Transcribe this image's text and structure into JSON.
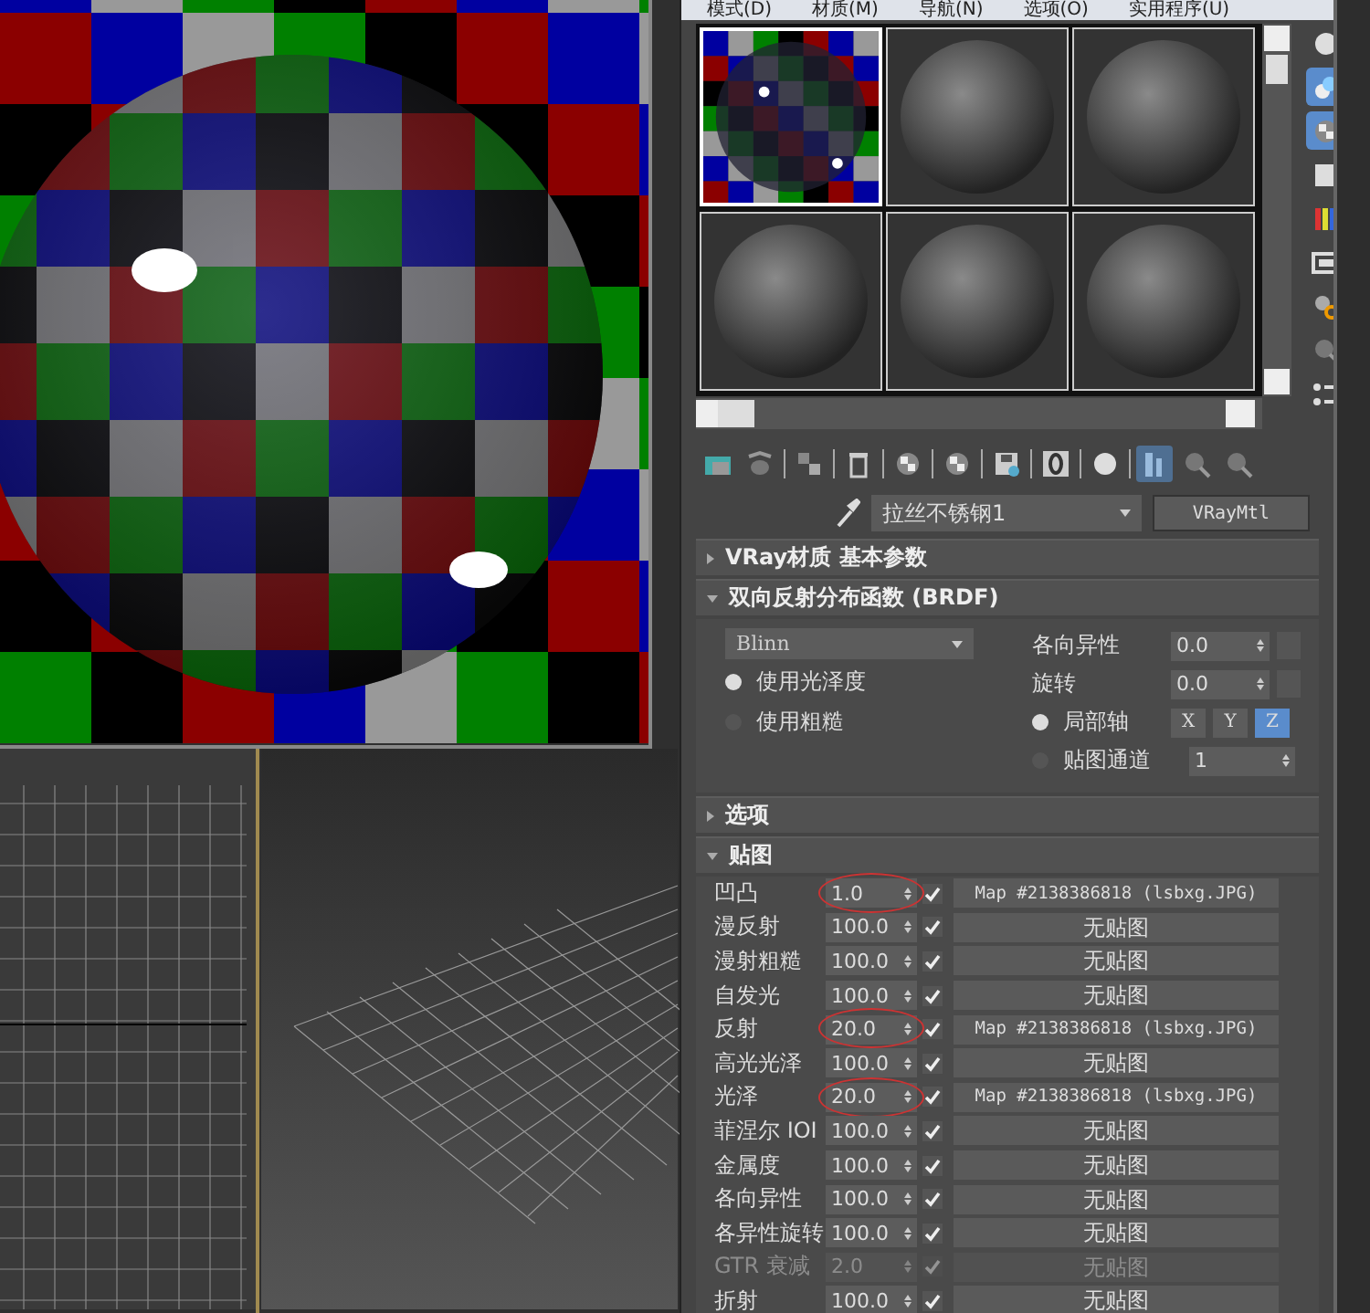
{
  "menu_bar": [
    "模式(D)",
    "材质(M)",
    "导航(N)",
    "选项(O)",
    "实用程序(U)"
  ],
  "slots": [
    {
      "kind": "checker",
      "selected": true
    },
    {
      "kind": "plain",
      "selected": false
    },
    {
      "kind": "plain",
      "selected": false
    },
    {
      "kind": "plain",
      "selected": false
    },
    {
      "kind": "plain",
      "selected": false
    },
    {
      "kind": "plain",
      "selected": false
    }
  ],
  "side_tools": [
    {
      "kind": "sphere",
      "on": false
    },
    {
      "kind": "backlight",
      "on": true
    },
    {
      "kind": "checker",
      "on": true
    },
    {
      "kind": "square",
      "on": false
    },
    {
      "kind": "bars",
      "on": false
    },
    {
      "kind": "film",
      "on": false
    },
    {
      "kind": "gear",
      "on": false
    },
    {
      "kind": "magnifier",
      "on": false
    },
    {
      "kind": "list",
      "on": false
    }
  ],
  "toolbar": [
    {
      "kind": "folder",
      "on": false
    },
    {
      "kind": "teapot",
      "on": false
    },
    {
      "kind": "sep"
    },
    {
      "kind": "assign",
      "on": false
    },
    {
      "kind": "sep"
    },
    {
      "kind": "trash",
      "on": false
    },
    {
      "kind": "sep"
    },
    {
      "kind": "checker",
      "on": false
    },
    {
      "kind": "sep"
    },
    {
      "kind": "checker",
      "on": false
    },
    {
      "kind": "sep"
    },
    {
      "kind": "disk",
      "on": false
    },
    {
      "kind": "sep"
    },
    {
      "kind": "zero",
      "on": false
    },
    {
      "kind": "sep"
    },
    {
      "kind": "sphere",
      "on": false
    },
    {
      "kind": "sep"
    },
    {
      "kind": "result",
      "on": true
    },
    {
      "kind": "magnifier",
      "on": false
    },
    {
      "kind": "magnifier",
      "on": false
    }
  ],
  "material_name": "拉丝不锈钢1",
  "material_type": "VRayMtl",
  "rollouts": [
    {
      "kind": "basic",
      "title": "VRay材质 基本参数",
      "expanded": false
    },
    {
      "kind": "brdf",
      "title": "双向反射分布函数 (BRDF)",
      "expanded": true,
      "brdf": {
        "type": "Blinn",
        "modes": [
          {
            "label": "使用光泽度",
            "selected": true
          },
          {
            "label": "使用粗糙",
            "selected": false
          }
        ],
        "anisotropy": {
          "label": "各向异性",
          "value": "0.0"
        },
        "rotation": {
          "label": "旋转",
          "value": "0.0"
        },
        "axis_modes": [
          {
            "label": "局部轴",
            "selected": true
          },
          {
            "label": "贴图通道",
            "selected": false
          }
        ],
        "axes": [
          {
            "label": "X",
            "selected": false
          },
          {
            "label": "Y",
            "selected": false
          },
          {
            "label": "Z",
            "selected": true
          }
        ],
        "channel": "1"
      }
    },
    {
      "kind": "options",
      "title": "选项",
      "expanded": false
    },
    {
      "kind": "maps",
      "title": "贴图",
      "expanded": true,
      "rows": [
        {
          "label": "凹凸",
          "value": "1.0",
          "checked": true,
          "map": "Map #2138386818 (lsbxg.JPG)",
          "circled": true,
          "disabled": false
        },
        {
          "label": "漫反射",
          "value": "100.0",
          "checked": true,
          "map": "无贴图",
          "circled": false,
          "disabled": false
        },
        {
          "label": "漫射粗糙",
          "value": "100.0",
          "checked": true,
          "map": "无贴图",
          "circled": false,
          "disabled": false
        },
        {
          "label": "自发光",
          "value": "100.0",
          "checked": true,
          "map": "无贴图",
          "circled": false,
          "disabled": false
        },
        {
          "label": "反射",
          "value": "20.0",
          "checked": true,
          "map": "Map #2138386818 (lsbxg.JPG)",
          "circled": true,
          "disabled": false
        },
        {
          "label": "高光光泽",
          "value": "100.0",
          "checked": true,
          "map": "无贴图",
          "circled": false,
          "disabled": false
        },
        {
          "label": "光泽",
          "value": "20.0",
          "checked": true,
          "map": "Map #2138386818 (lsbxg.JPG)",
          "circled": true,
          "disabled": false
        },
        {
          "label": "菲涅尔 IOI",
          "value": "100.0",
          "checked": true,
          "map": "无贴图",
          "circled": false,
          "disabled": false
        },
        {
          "label": "金属度",
          "value": "100.0",
          "checked": true,
          "map": "无贴图",
          "circled": false,
          "disabled": false
        },
        {
          "label": "各向异性",
          "value": "100.0",
          "checked": true,
          "map": "无贴图",
          "circled": false,
          "disabled": false
        },
        {
          "label": "各异性旋转",
          "value": "100.0",
          "checked": true,
          "map": "无贴图",
          "circled": false,
          "disabled": false
        },
        {
          "label": "GTR 衰减",
          "value": "2.0",
          "checked": true,
          "map": "无贴图",
          "circled": false,
          "disabled": true
        },
        {
          "label": "折射",
          "value": "100.0",
          "checked": true,
          "map": "无贴图",
          "circled": false,
          "disabled": false
        }
      ]
    }
  ]
}
